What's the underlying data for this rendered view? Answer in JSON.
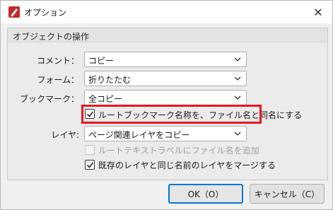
{
  "window": {
    "title": "オプション",
    "close_glyph": "✕"
  },
  "group": {
    "title": "オブジェクトの操作"
  },
  "fields": {
    "comment": {
      "label": "コメント：",
      "value": "コピー"
    },
    "form": {
      "label": "フォーム：",
      "value": "折りたたむ"
    },
    "bookmark": {
      "label": "ブックマーク：",
      "value": "全コピー"
    },
    "layer": {
      "label": "レイヤ:",
      "value": "ページ関連レイヤをコピー"
    }
  },
  "checkboxes": {
    "root_bookmark": {
      "label": "ルートブックマーク名称を、ファイル名と同名にする",
      "checked": true,
      "enabled": true
    },
    "root_text_label": {
      "label": "ルートテキストラベルにファイル名を追加",
      "checked": false,
      "enabled": false
    },
    "merge_layers": {
      "label": "既存のレイヤと同じ名前のレイヤをマージする",
      "checked": true,
      "enabled": true
    }
  },
  "buttons": {
    "ok": "OK（O）",
    "cancel": "キャンセル（C）"
  },
  "colors": {
    "highlight": "#e8181e",
    "accent": "#0078d4",
    "icon_red": "#c62828"
  },
  "icons": {
    "app": "red-pen-icon",
    "close": "close-icon",
    "dropdown": "chevron-down-icon",
    "check": "checkmark-icon"
  }
}
